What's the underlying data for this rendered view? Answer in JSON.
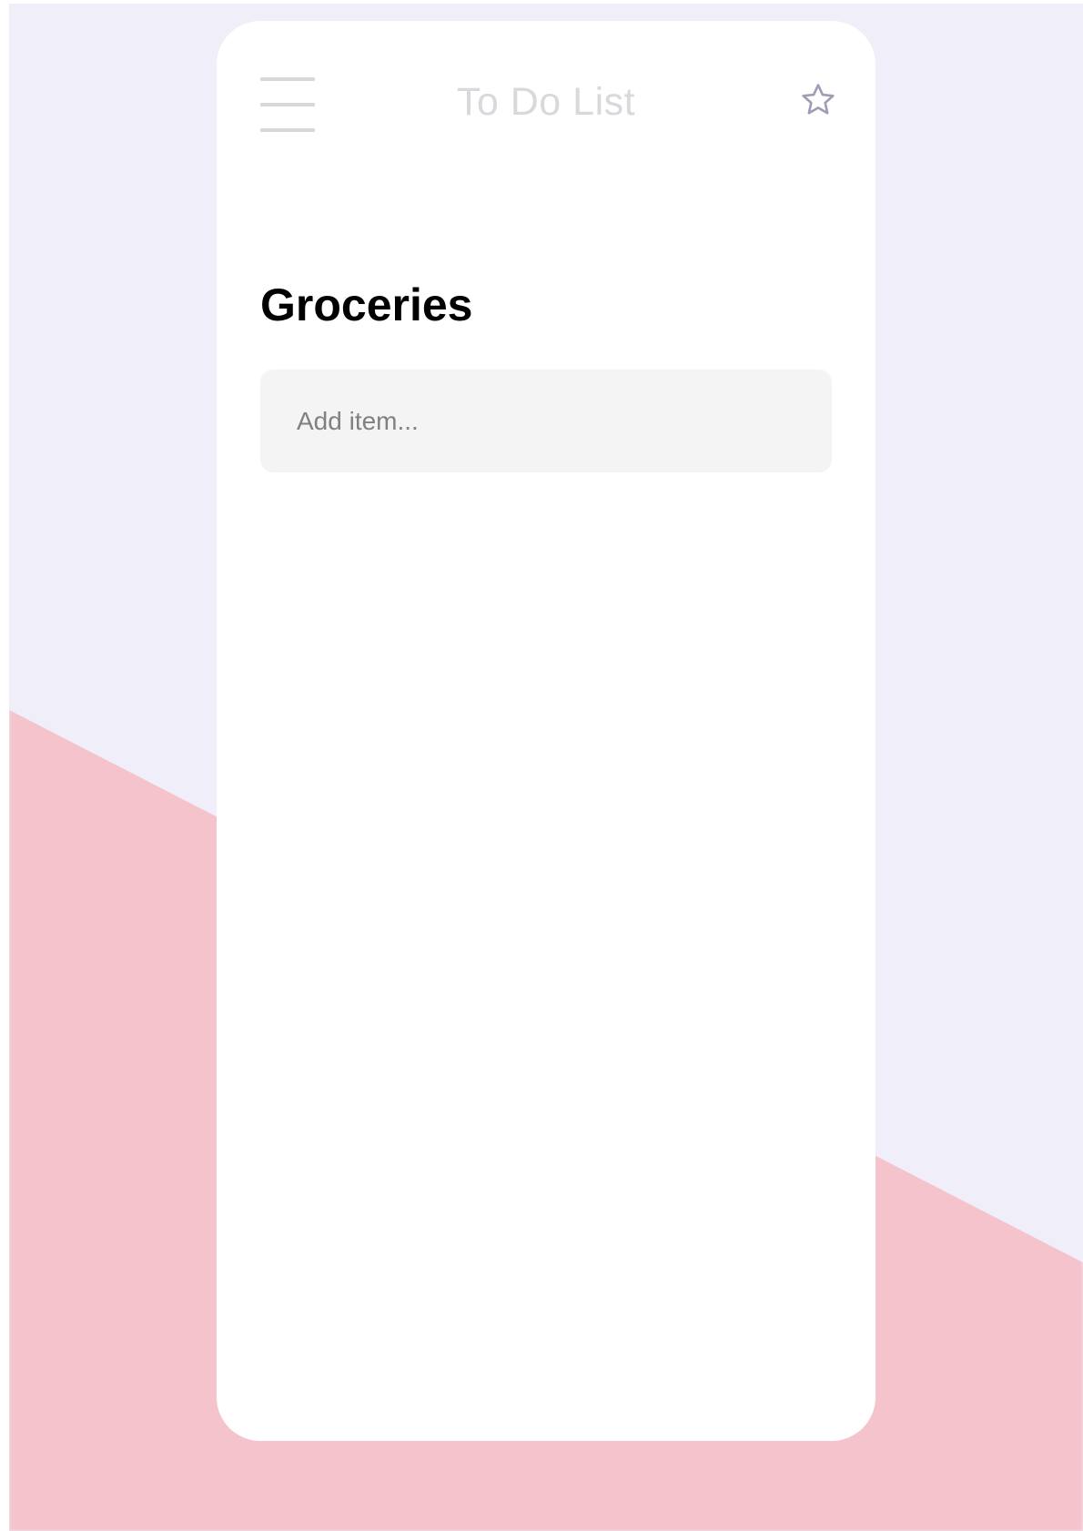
{
  "header": {
    "title": "To Do List",
    "menu_icon": "hamburger-menu-icon",
    "favorite_icon": "star-outline-icon"
  },
  "list": {
    "title": "Groceries",
    "add_placeholder": "Add item...",
    "add_value": "",
    "items": []
  },
  "colors": {
    "background": "#f0eff9",
    "accent_band": "#f4c3cc",
    "card": "#ffffff",
    "input_background": "#f4f4f4",
    "star_stroke": "#9d9db5"
  }
}
